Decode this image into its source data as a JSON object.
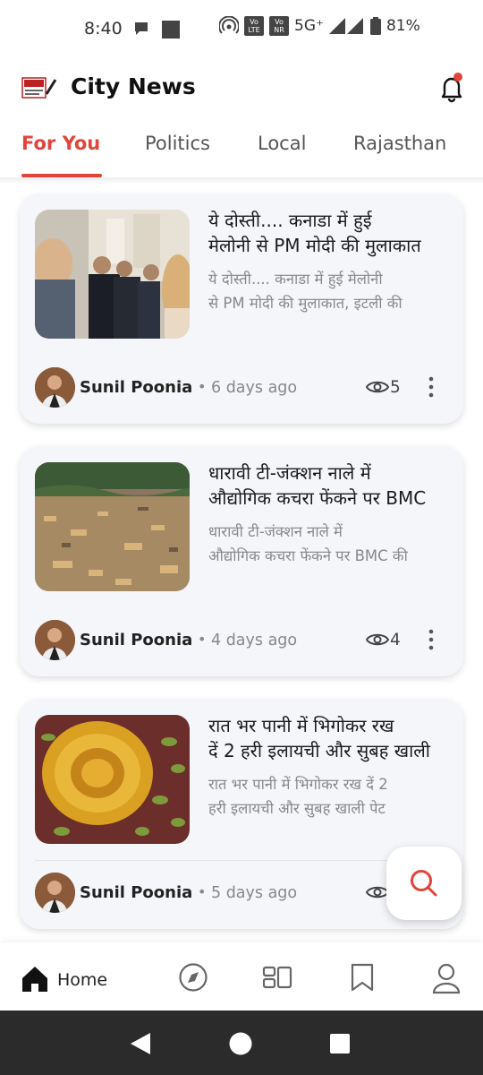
{
  "status_bar": {
    "time": "8:40",
    "network": "5G⁺",
    "volte1": "Vo LTE",
    "volte2": "Vo NR",
    "battery": "81%"
  },
  "header": {
    "title": "City News",
    "logo_text": "City News"
  },
  "tabs": [
    {
      "label": "For You",
      "active": true
    },
    {
      "label": "Politics",
      "active": false
    },
    {
      "label": "Local",
      "active": false
    },
    {
      "label": "Rajasthan",
      "active": false
    }
  ],
  "articles": [
    {
      "headline_l1": "ये दोस्ती.... कनाडा में हुई",
      "headline_l2": "मेलोनी से PM मोदी की मुलाकात",
      "summary_l1": "ये दोस्ती.... कनाडा में हुई मेलोनी",
      "summary_l2": "से PM मोदी की मुलाकात, इटली की",
      "author": "Sunil Poonia",
      "time_ago": "6 days ago",
      "views": "5"
    },
    {
      "headline_l1": "धारावी टी-जंक्शन नाले में",
      "headline_l2": "औद्योगिक कचरा फेंकने पर BMC",
      "summary_l1": "धारावी टी-जंक्शन नाले में",
      "summary_l2": "औद्योगिक कचरा फेंकने पर BMC की",
      "author": "Sunil Poonia",
      "time_ago": "4 days ago",
      "views": "4"
    },
    {
      "headline_l1": "रात भर पानी में भिगोकर रख",
      "headline_l2": "दें 2 हरी इलायची और सुबह खाली",
      "summary_l1": "रात भर पानी में भिगोकर रख दें 2",
      "summary_l2": "हरी इलायची और सुबह खाली पेट",
      "author": "Sunil Poonia",
      "time_ago": "5 days ago",
      "views": ""
    }
  ],
  "bottom_nav": {
    "home_label": "Home"
  },
  "colors": {
    "accent": "#e0443a",
    "card_bg": "#f5f6fa"
  }
}
